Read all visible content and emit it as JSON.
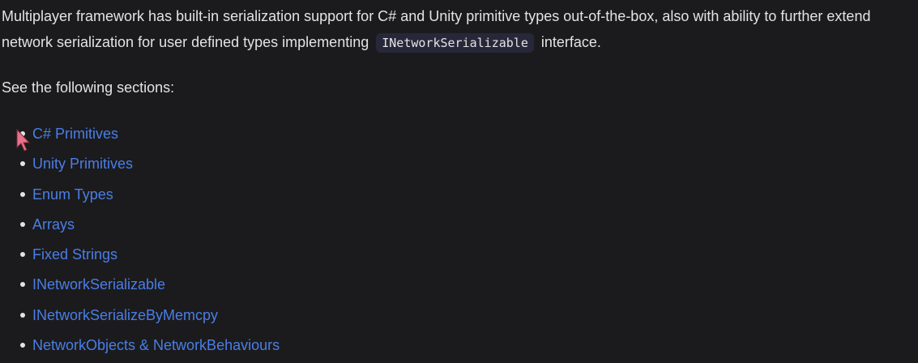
{
  "intro": {
    "text_before": "Multiplayer framework has built-in serialization support for C# and Unity primitive types out-of-the-box, also with ability to further extend network serialization for user defined types implementing",
    "code": "INetworkSerializable",
    "text_after": "interface."
  },
  "see_label": "See the following sections:",
  "sections": [
    {
      "label": "C# Primitives"
    },
    {
      "label": "Unity Primitives"
    },
    {
      "label": "Enum Types"
    },
    {
      "label": "Arrays"
    },
    {
      "label": "Fixed Strings"
    },
    {
      "label": "INetworkSerializable"
    },
    {
      "label": "INetworkSerializeByMemcpy"
    },
    {
      "label": "NetworkObjects & NetworkBehaviours"
    }
  ],
  "colors": {
    "background": "#1b1b1d",
    "text": "#e3e3e3",
    "link": "#4a7ee6",
    "cursor": "#e8738a"
  }
}
